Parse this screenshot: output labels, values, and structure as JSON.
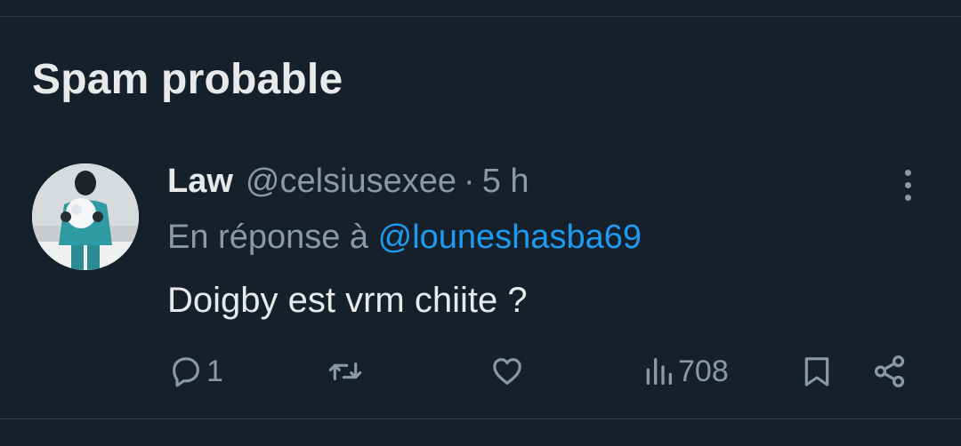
{
  "section": {
    "title": "Spam probable"
  },
  "tweet": {
    "display_name": "Law",
    "handle": "@celsiusexee",
    "separator": "·",
    "time": "5 h",
    "reply_prefix": "En réponse à",
    "reply_to": "@louneshasba69",
    "text": "Doigby est vrm chiite ?",
    "actions": {
      "reply_count": "1",
      "retweet_count": "",
      "like_count": "",
      "views_count": "708"
    },
    "icons": {
      "more": "more-vertical-icon",
      "reply": "reply-icon",
      "retweet": "retweet-icon",
      "like": "heart-icon",
      "views": "views-icon",
      "bookmark": "bookmark-icon",
      "share": "share-icon"
    }
  },
  "colors": {
    "background": "#15202b",
    "text_primary": "#e7e9ea",
    "text_secondary": "#8b98a5",
    "accent": "#1d9bf0",
    "divider": "#2f3d4a"
  }
}
